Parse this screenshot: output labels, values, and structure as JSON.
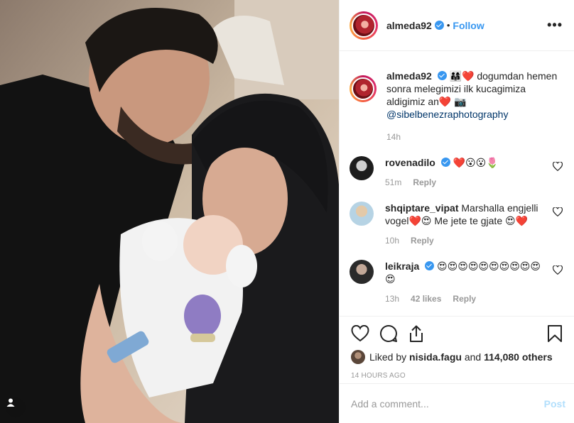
{
  "header": {
    "username": "almeda92",
    "separator": "•",
    "follow_label": "Follow",
    "more_label": "•••"
  },
  "caption": {
    "username": "almeda92",
    "text": "👨‍👩‍👧❤️ dogumdan hemen sonra melegimizi ilk kucagimiza aldigimiz an❤️ 📷",
    "mention": "@sibelbenezraphotography",
    "time": "14h"
  },
  "comments": [
    {
      "username": "rovenadilo",
      "text": "❤️😮😮🌷",
      "time": "51m",
      "likes": "",
      "reply": "Reply"
    },
    {
      "username": "shqiptare_vipat",
      "text": "Marshalla engjelli vogel❤️😍 Me jete te gjate 😍❤️",
      "time": "10h",
      "likes": "",
      "reply": "Reply"
    },
    {
      "username": "leikraja",
      "text": "😍😍😍😍😍😍😍😍😍😍😍",
      "time": "13h",
      "likes": "42 likes",
      "reply": "Reply"
    }
  ],
  "likes": {
    "prefix": "Liked by",
    "user": "nisida.fagu",
    "joiner": "and",
    "others": "114,080 others"
  },
  "timestamp": "14 HOURS AGO",
  "add_comment": {
    "placeholder": "Add a comment...",
    "post_label": "Post"
  },
  "colors": {
    "accent": "#3897f0",
    "muted": "#999999",
    "post_disabled": "#b2dffc"
  },
  "icons": [
    "heart-icon",
    "comment-icon",
    "share-icon",
    "bookmark-icon",
    "user-tag-icon",
    "verified-icon"
  ]
}
